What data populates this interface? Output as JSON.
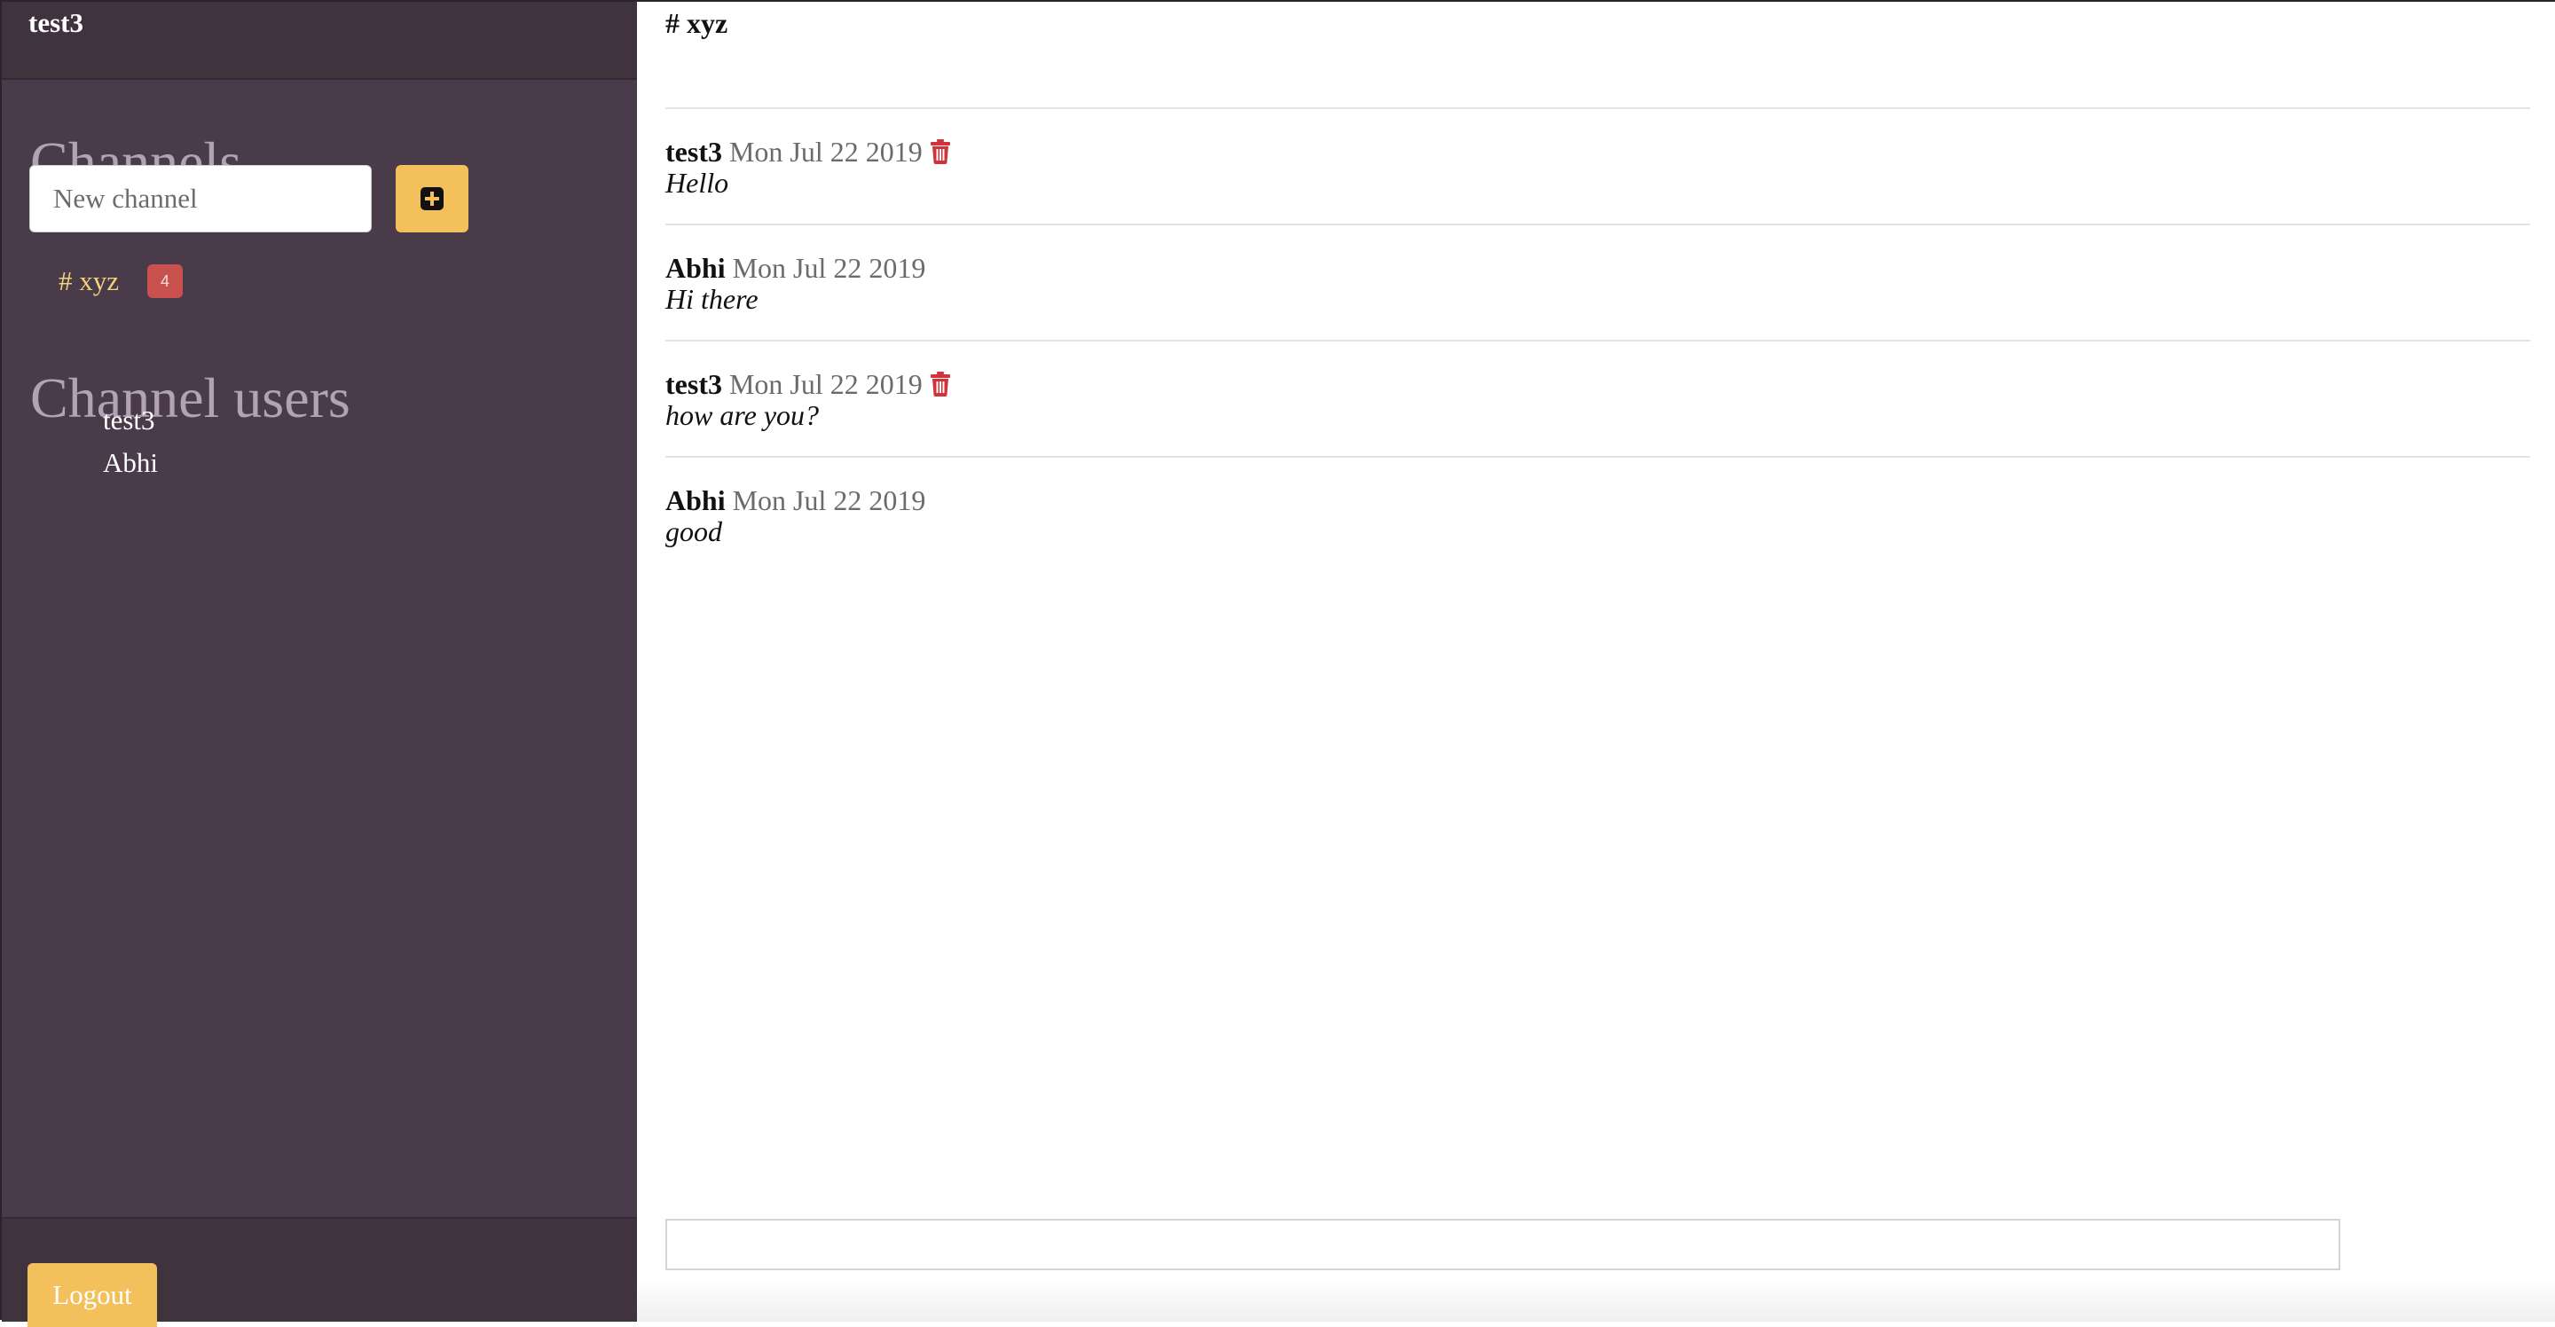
{
  "sidebar": {
    "username": "test3",
    "channels_title": "Channels",
    "new_channel_placeholder": "New channel",
    "add_channel_icon": "plus-square-icon",
    "channels": [
      {
        "label": "# xyz",
        "badge": "4"
      }
    ],
    "users_title": "Channel users",
    "users": [
      "test3",
      "Abhi"
    ],
    "logout_label": "Logout"
  },
  "main": {
    "channel_title": "# xyz",
    "messages": [
      {
        "author": "test3",
        "date": "Mon Jul 22 2019",
        "text": "Hello",
        "deletable": true
      },
      {
        "author": "Abhi",
        "date": "Mon Jul 22 2019",
        "text": "Hi there",
        "deletable": false
      },
      {
        "author": "test3",
        "date": "Mon Jul 22 2019",
        "text": "how are you?",
        "deletable": true
      },
      {
        "author": "Abhi",
        "date": "Mon Jul 22 2019",
        "text": "good",
        "deletable": false
      }
    ],
    "compose_placeholder": ""
  },
  "colors": {
    "sidebar_bg": "#4a3b4a",
    "sidebar_header_bg": "#3f333e",
    "accent": "#f3c05b",
    "channel_active": "#f3d27a",
    "badge": "#c9514d",
    "delete_icon": "#d0333a"
  },
  "icons": {
    "delete": "trash-icon",
    "add": "plus-square-icon"
  }
}
